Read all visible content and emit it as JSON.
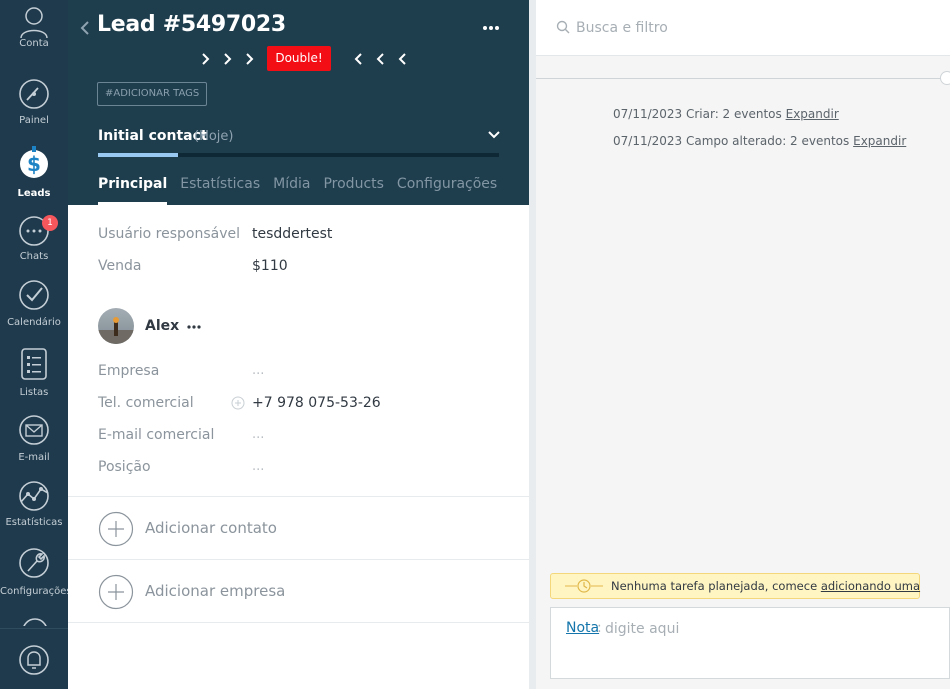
{
  "nav": {
    "items": [
      {
        "label": "Conta",
        "icon": "user-icon"
      },
      {
        "label": "Painel",
        "icon": "gauge-icon"
      },
      {
        "label": "Leads",
        "icon": "dollar-icon"
      },
      {
        "label": "Chats",
        "icon": "chat-icon",
        "badge": "1"
      },
      {
        "label": "Calendário",
        "icon": "check-circle-icon"
      },
      {
        "label": "Listas",
        "icon": "list-icon"
      },
      {
        "label": "E-mail",
        "icon": "mail-icon"
      },
      {
        "label": "Estatísticas",
        "icon": "stats-icon"
      },
      {
        "label": "Configurações",
        "icon": "wrench-icon"
      }
    ],
    "active": "Leads"
  },
  "lead": {
    "title": "Lead #5497023",
    "double_label": "Double!",
    "tag_button": "#ADICIONAR TAGS",
    "stage_name": "Initial contact",
    "stage_date": "(Hoje)",
    "stage_progress": 0.2,
    "tabs": [
      "Principal",
      "Estatísticas",
      "Mídia",
      "Products",
      "Configurações"
    ],
    "active_tab": "Principal"
  },
  "fields": {
    "responsavel_label": "Usuário responsável",
    "responsavel_value": "tesddertest",
    "venda_label": "Venda",
    "venda_value": "$110"
  },
  "contact": {
    "name": "Alex",
    "empresa_label": "Empresa",
    "empresa_value": "...",
    "tel_label": "Tel. comercial",
    "tel_value": "+7 978 075-53-26",
    "email_label": "E-mail comercial",
    "email_value": "...",
    "posicao_label": "Posição",
    "posicao_value": "..."
  },
  "actions": {
    "add_contact": "Adicionar contato",
    "add_company": "Adicionar empresa"
  },
  "feed": {
    "search_placeholder": "Busca e filtro",
    "events": [
      {
        "text": "07/11/2023 Criar: 2 eventos",
        "link": "Expandir"
      },
      {
        "text": "07/11/2023 Campo alterado: 2 eventos",
        "link": "Expandir"
      }
    ],
    "notice_text": "Nenhuma tarefa planejada, comece",
    "notice_link": "adicionando uma",
    "note_link": "Nota",
    "note_colon": ":",
    "note_placeholder": "digite aqui"
  },
  "colors": {
    "nav_bg": "#1f3a4c",
    "header_bg": "#1e3d4d",
    "double_red": "#f30e16",
    "progress_fill": "#99c9f0",
    "badge_red": "#f5575d",
    "link_blue": "#1375ab"
  }
}
